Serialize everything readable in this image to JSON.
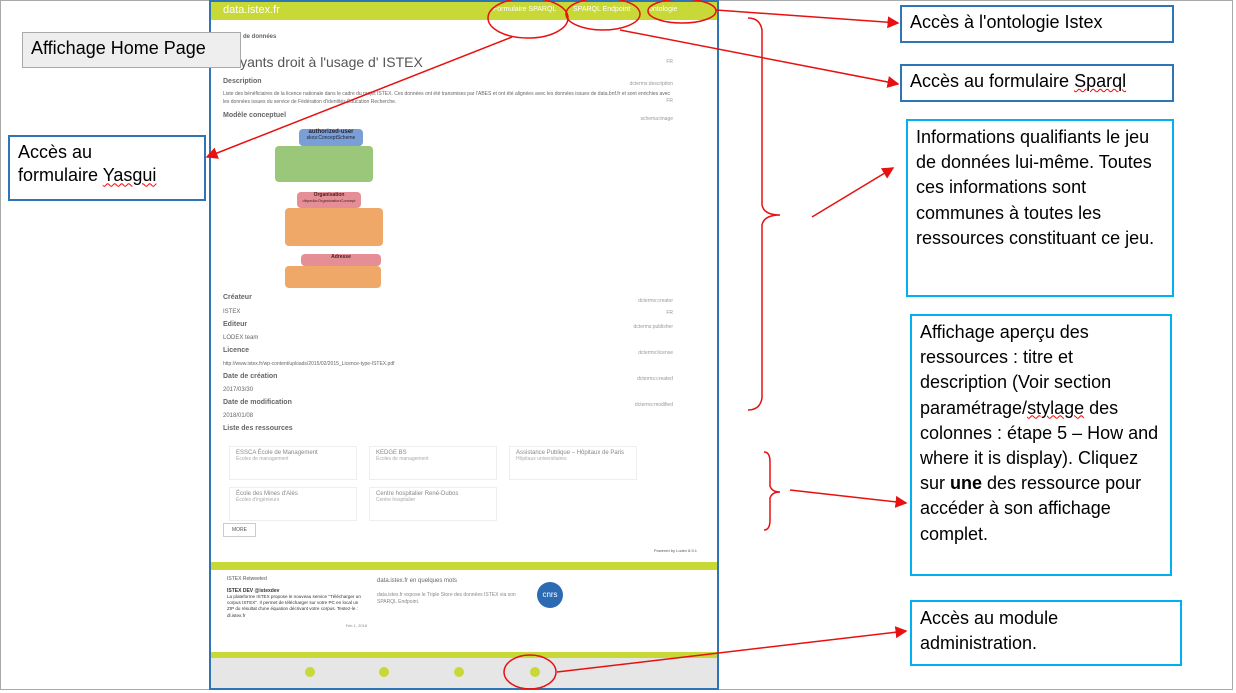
{
  "site": {
    "brand": "data.istex.fr",
    "nav": [
      "Formulaire SPARQL",
      "SPARQL Endpoint",
      "ontologie"
    ],
    "breadcrumb": "Jeu de données",
    "page_title": "Ayants droit à l'usage d' ISTEX",
    "lang_fr": "FR",
    "description_label": "Description",
    "description_prop": "dcterms:description",
    "description_text": "Liste des bénéficiaires de la licence nationale dans le cadre du projet ISTEX. Ces données ont été transmises par l'ABES et ont été alignées avec les données issues de data.bnf.fr et sont enrichies avec les données issues du service de Fédération d'identités Éducation Recherche.",
    "model_label": "Modèle conceptuel",
    "model_prop": "schema:image",
    "diagram": {
      "top_title": "authorized-user",
      "top_sub": "skos:ConceptScheme",
      "mid_title": "Organisation",
      "mid_sub": "dbpedia:OrganizationConcept",
      "bot_title": "Adresse",
      "bot_sub": "vcard:Address"
    },
    "fields": [
      {
        "label": "Créateur",
        "prop": "dcterms:creator",
        "value": "ISTEX",
        "lang": "FR"
      },
      {
        "label": "Editeur",
        "prop": "dcterms:publisher",
        "value": "LODEX team",
        "lang": ""
      },
      {
        "label": "Licence",
        "prop": "dcterms:license",
        "value": "http://www.istex.fr/wp-content/uploads/2015/02/2015_Licence-type-ISTEX.pdf",
        "lang": ""
      },
      {
        "label": "Date de création",
        "prop": "dcterms:created",
        "value": "2017/03/30",
        "lang": ""
      },
      {
        "label": "Date de modification",
        "prop": "dcterms:modified",
        "value": "2018/01/08",
        "lang": ""
      }
    ],
    "resources_label": "Liste des ressources",
    "resources": [
      {
        "title": "ESSCA École de Management",
        "sub": "Écoles de management"
      },
      {
        "title": "KEDGE BS",
        "sub": "Écoles de management"
      },
      {
        "title": "Assistance Publique – Hôpitaux de Paris",
        "sub": "Hôpitaux universitaires"
      },
      {
        "title": "École des Mines d'Alès",
        "sub": "Écoles d'ingénieurs"
      },
      {
        "title": "Centre hospitalier René-Dubos",
        "sub": "Centre hospitalier"
      }
    ],
    "more_label": "MORE",
    "powered": "Powered by Lodex 8.9.1",
    "tweet": {
      "retweet": "ISTEX Retweeted",
      "author": "ISTEX DEV @istexdev",
      "text": "La plateforme ISTEX propose le nouveau service \"Télécharger un corpus ISTEX\". Il permet de télécharger sur votre PC en local un ZIP du résultat d'une équation décrivant votre corpus. Testez-le : dl.istex.fr",
      "date": "Feb 1, 2018"
    },
    "about_title": "data.istex.fr en quelques mots",
    "about_text": "data.istex.fr expose le Triple Store des données ISTEX via son SPARQL Endpoint.",
    "logo_text": "cnrs"
  },
  "annotations": {
    "home": "Affichage Home Page",
    "ontology": "Accès à l'ontologie Istex",
    "sparql_form_1": "Accès au formulaire ",
    "sparql_form_2": "Sparql",
    "yasgui_1": "Accès au",
    "yasgui_2": "formulaire ",
    "yasgui_3": "Yasgui",
    "info": "Informations qualifiants le jeu de données lui-même. Toutes ces informations sont communes à toutes les ressources constituant ce jeu.",
    "preview_a": "Affichage aperçu des ressources : titre et description (Voir section paramétrage/",
    "preview_sq": "stylage",
    "preview_b": " des colonnes : étape 5 – How and where it is display). Cliquez sur ",
    "preview_bold": "une",
    "preview_c": " des ressource pour accéder à son affichage complet.",
    "admin": "Accès au module administration."
  },
  "colors": {
    "accent": "#c8d836",
    "annotation_border": "#2e75b6",
    "info_border": "#00b0f0",
    "arrow": "#e81010"
  }
}
